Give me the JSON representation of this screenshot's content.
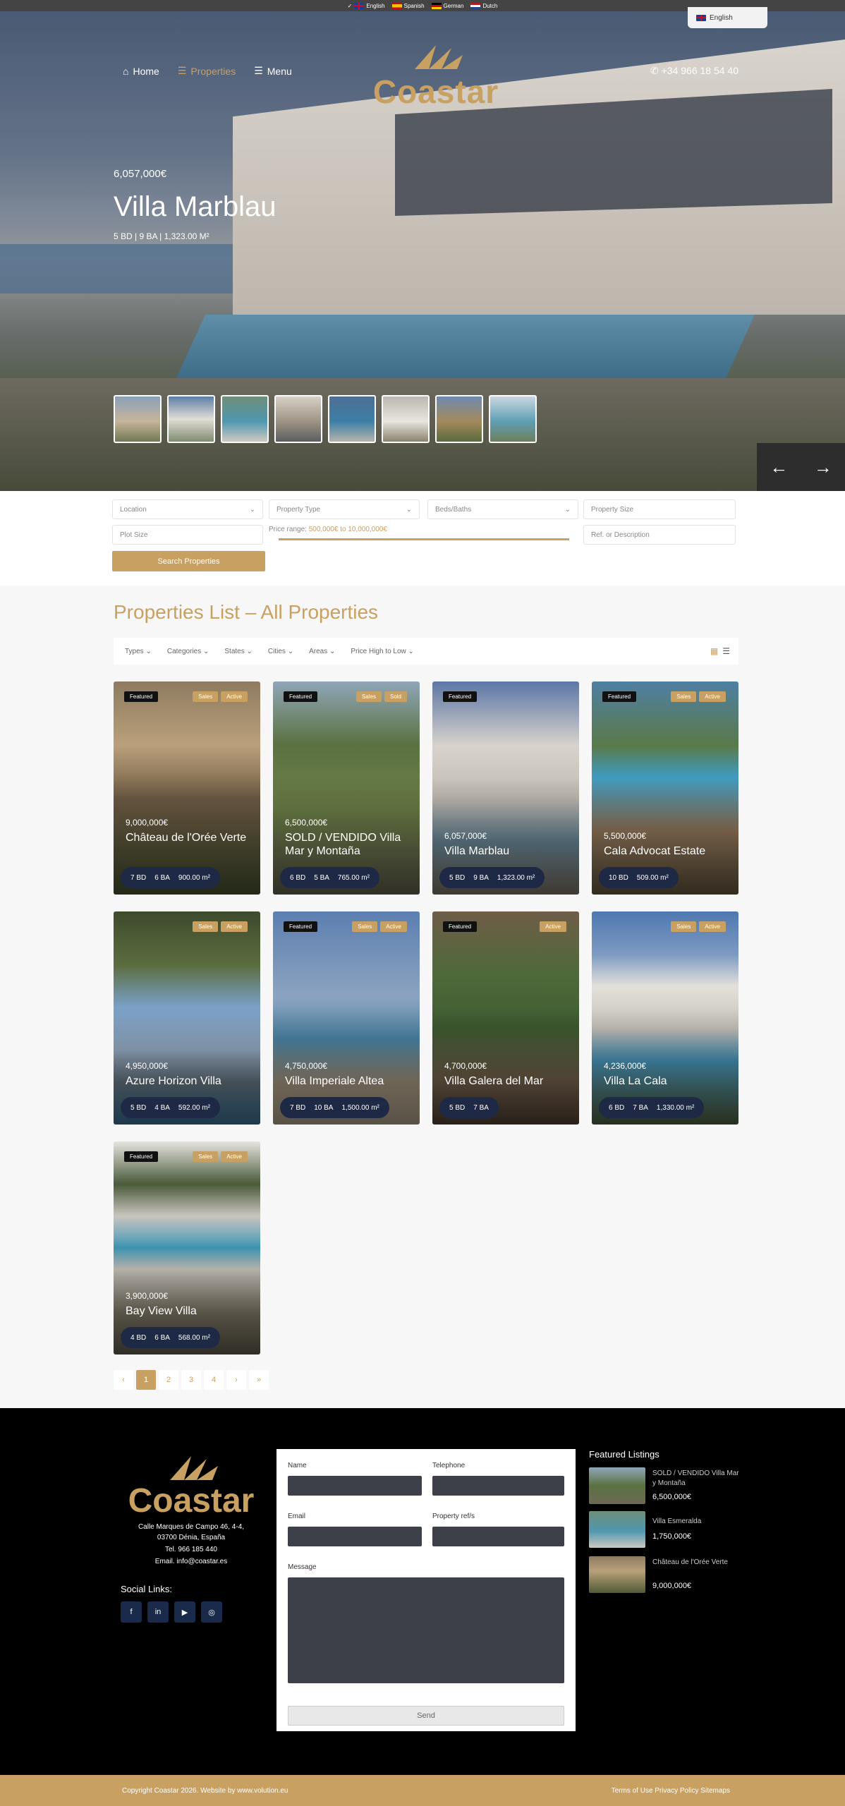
{
  "languages": [
    {
      "label": "English",
      "flag": "en"
    },
    {
      "label": "Spanish",
      "flag": "es"
    },
    {
      "label": "German",
      "flag": "de"
    },
    {
      "label": "Dutch",
      "flag": "nl"
    }
  ],
  "language_dropdown": {
    "selected": "English"
  },
  "nav": {
    "home": "Home",
    "properties": "Properties",
    "menu": "Menu",
    "phone": "+34 966 18 54 40"
  },
  "brand": {
    "name": "Coastar",
    "color": "#c8a062"
  },
  "hero": {
    "price": "6,057,000€",
    "title": "Villa Marblau",
    "meta": "5 BD | 9 BA | 1,323.00 M²",
    "thumbnail_count": 8
  },
  "search": {
    "location": "Location",
    "property_type": "Property Type",
    "beds_baths": "Beds/Baths",
    "property_size": "Property Size",
    "plot_size": "Plot Size",
    "price_range_label": "Price range:",
    "price_range_value": "500,000€ to 10,000,000€",
    "ref": "Ref. or Description",
    "button": "Search Properties"
  },
  "list": {
    "title": "Properties List – All Properties",
    "filters": [
      "Types",
      "Categories",
      "States",
      "Cities",
      "Areas",
      "Price High to Low"
    ]
  },
  "cards": [
    {
      "featured": "Featured",
      "badges": [
        "Sales",
        "Active"
      ],
      "price": "9,000,000€",
      "name": "Château de l'Orée Verte",
      "beds": "7 BD",
      "baths": "6 BA",
      "size": "900.00 m²"
    },
    {
      "featured": "Featured",
      "badges": [
        "Sales",
        "Sold"
      ],
      "price": "6,500,000€",
      "name": "SOLD / VENDIDO Villa Mar y Montaña",
      "beds": "6 BD",
      "baths": "5 BA",
      "size": "765.00 m²"
    },
    {
      "featured": "Featured",
      "badges": [],
      "price": "6,057,000€",
      "name": "Villa Marblau",
      "beds": "5 BD",
      "baths": "9 BA",
      "size": "1,323.00 m²"
    },
    {
      "featured": "Featured",
      "badges": [
        "Sales",
        "Active"
      ],
      "price": "5,500,000€",
      "name": "Cala Advocat Estate",
      "beds": "10 BD",
      "baths": "",
      "size": "509.00 m²"
    },
    {
      "featured": "",
      "badges": [
        "Sales",
        "Active"
      ],
      "price": "4,950,000€",
      "name": "Azure Horizon Villa",
      "beds": "5 BD",
      "baths": "4 BA",
      "size": "592.00 m²"
    },
    {
      "featured": "Featured",
      "badges": [
        "Sales",
        "Active"
      ],
      "price": "4,750,000€",
      "name": "Villa Imperiale Altea",
      "beds": "7 BD",
      "baths": "10 BA",
      "size": "1,500.00 m²"
    },
    {
      "featured": "Featured",
      "badges": [
        "Active"
      ],
      "price": "4,700,000€",
      "name": "Villa Galera del Mar",
      "beds": "5 BD",
      "baths": "7 BA",
      "size": ""
    },
    {
      "featured": "",
      "badges": [
        "Sales",
        "Active"
      ],
      "price": "4,236,000€",
      "name": "Villa La Cala",
      "beds": "6 BD",
      "baths": "7 BA",
      "size": "1,330.00 m²"
    },
    {
      "featured": "Featured",
      "badges": [
        "Sales",
        "Active"
      ],
      "price": "3,900,000€",
      "name": "Bay View Villa",
      "beds": "4 BD",
      "baths": "6 BA",
      "size": "568.00 m²"
    }
  ],
  "pagination": {
    "prev": "‹",
    "pages": [
      "1",
      "2",
      "3",
      "4"
    ],
    "next": "›",
    "last": "»",
    "current": "1"
  },
  "footer": {
    "address_line1": "Calle Marques de Campo 46, 4-4,",
    "address_line2": "03700 Dénia, España",
    "tel": "Tel. 966 185 440",
    "email": "Email. info@coastar.es",
    "social_title": "Social Links:",
    "socials": [
      "f",
      "in",
      "▶",
      "◎"
    ],
    "form": {
      "name": "Name",
      "telephone": "Telephone",
      "email": "Email",
      "ref": "Property ref/s",
      "message": "Message",
      "send": "Send"
    },
    "featured_title": "Featured Listings",
    "featured": [
      {
        "name": "SOLD / VENDIDO Villa Mar y Montaña",
        "price": "6,500,000€"
      },
      {
        "name": "Villa Esmeralda",
        "price": "1,750,000€"
      },
      {
        "name": "Château de l'Orée Verte",
        "price": "9,000,000€"
      }
    ]
  },
  "bottom": {
    "copyright": "Copyright Coastar 2026. Website by www.volution.eu",
    "links": "Terms of Use Privacy Policy Sitemaps"
  }
}
